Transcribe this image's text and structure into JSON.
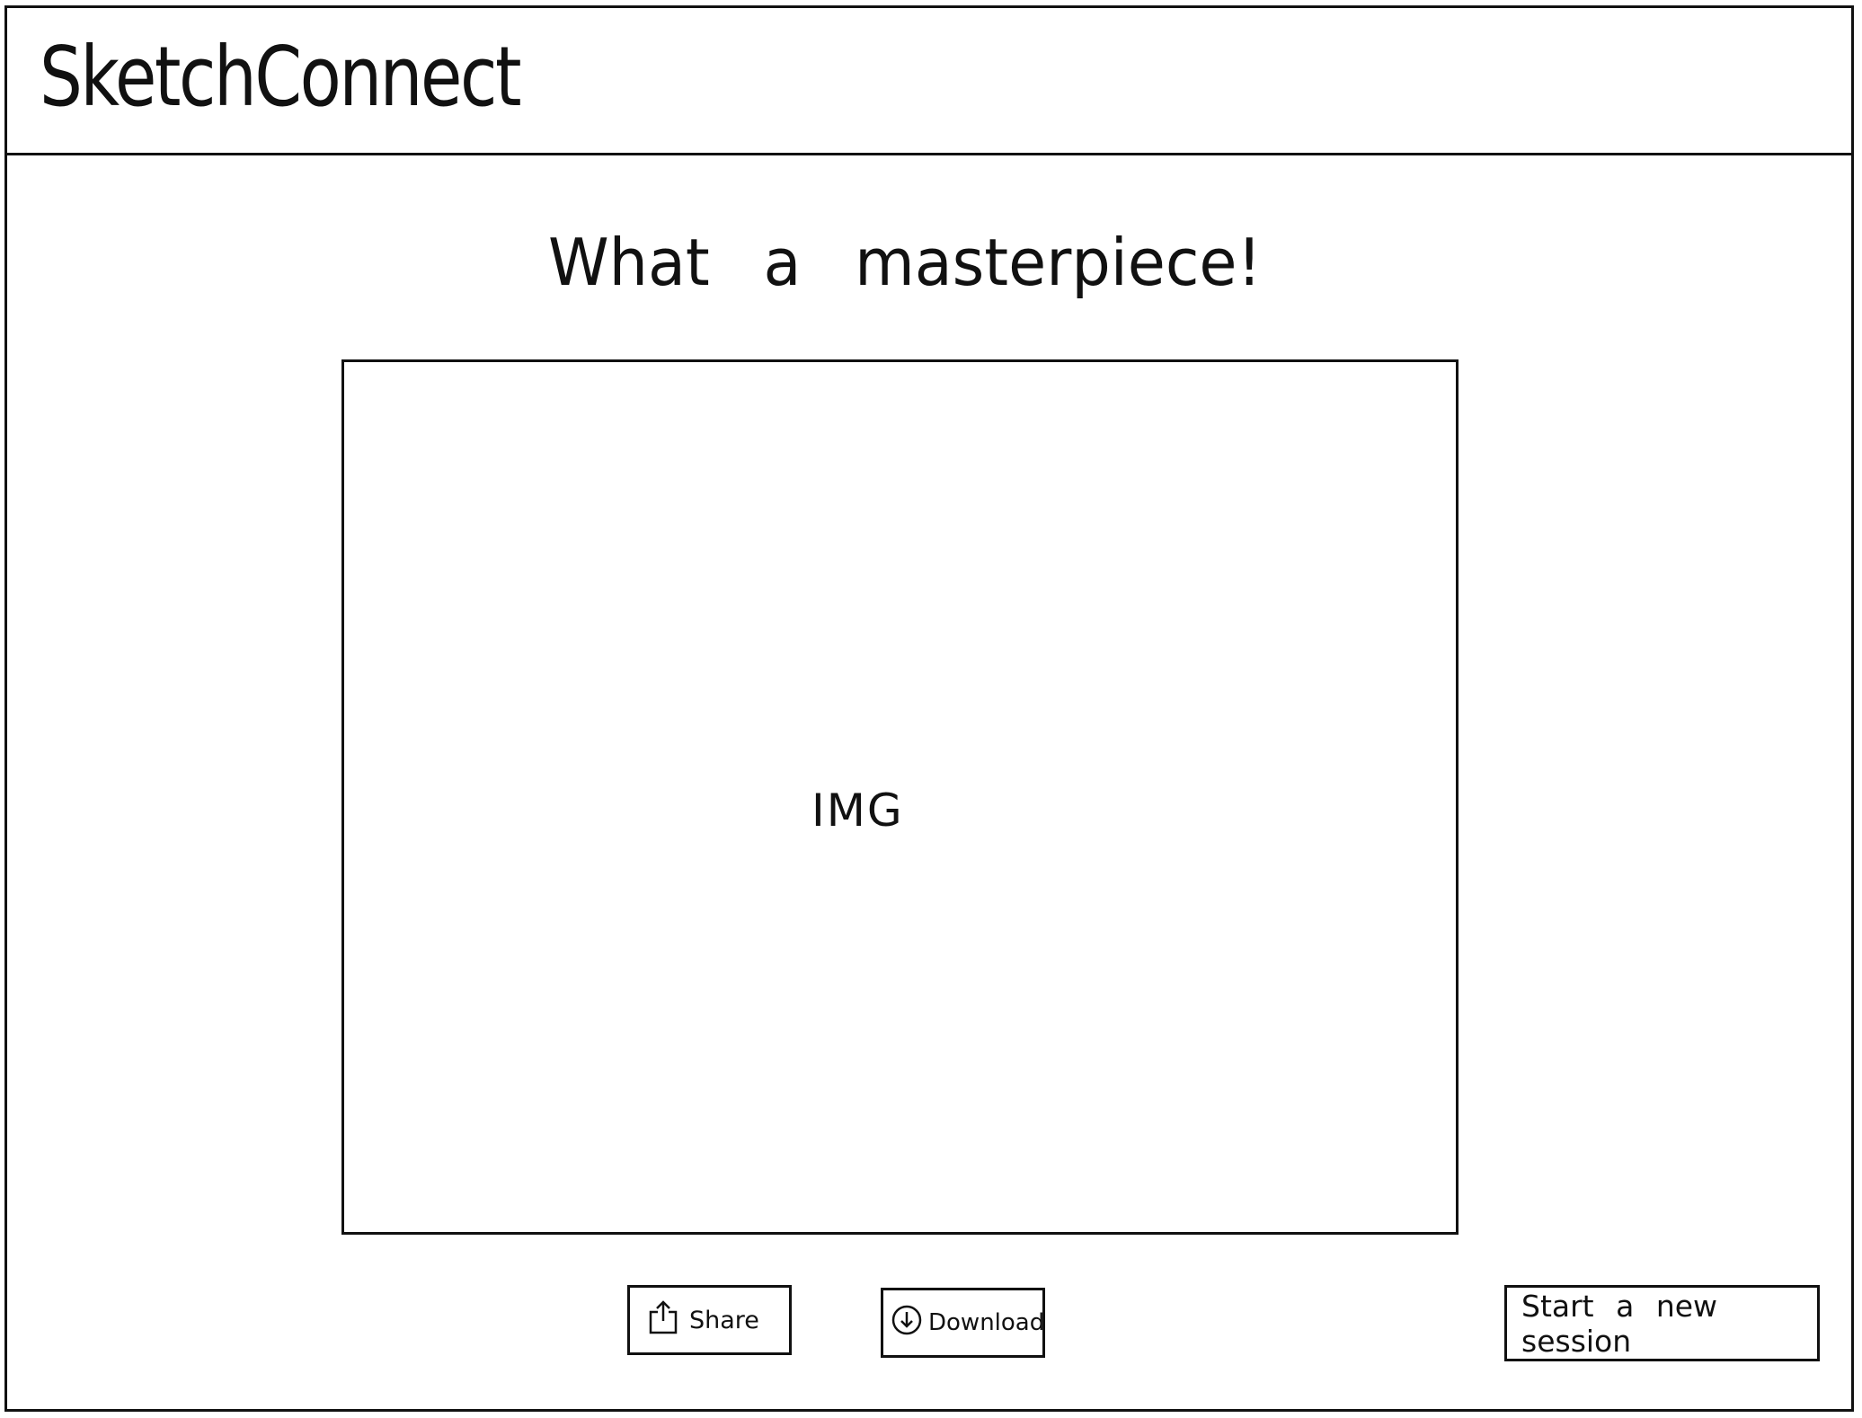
{
  "header": {
    "app_title": "SketchConnect"
  },
  "main": {
    "headline": "What a masterpiece!",
    "image_placeholder": "IMG"
  },
  "actions": {
    "share_label": "Share",
    "share_icon": "share-icon",
    "download_label": "Download",
    "download_icon": "download-icon",
    "new_session_label": "Start a new session"
  }
}
